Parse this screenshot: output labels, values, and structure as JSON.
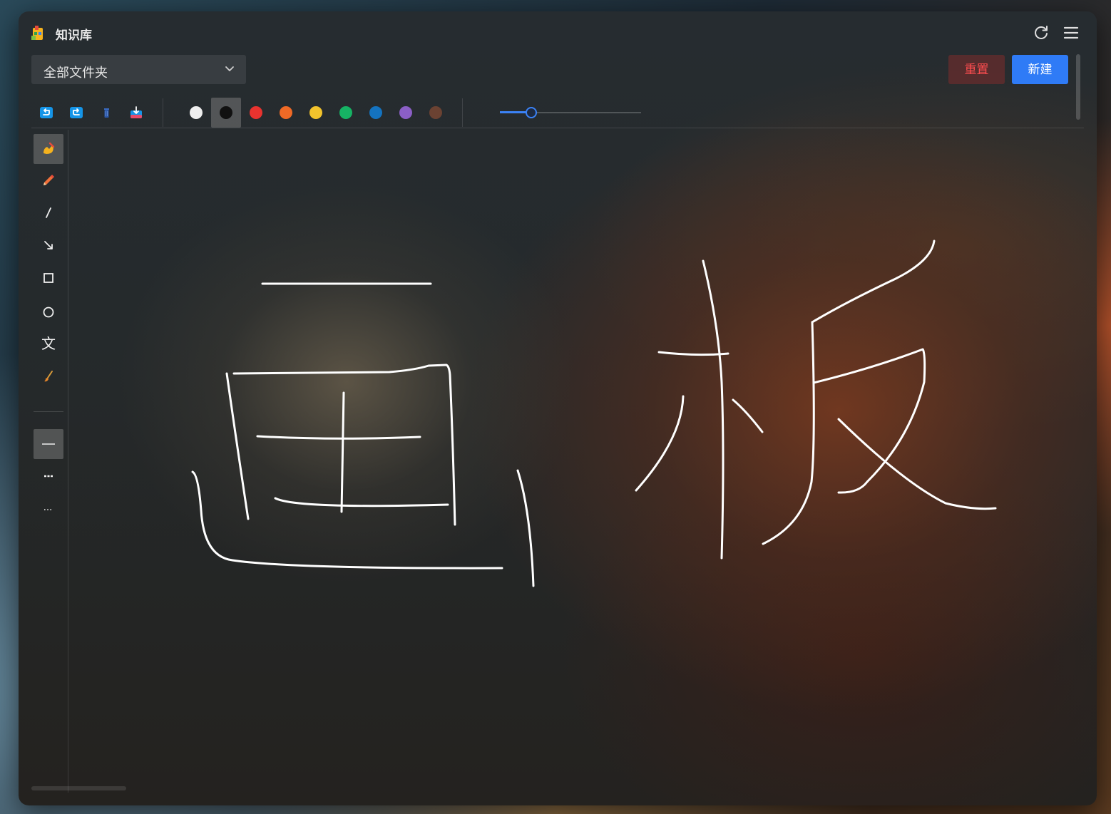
{
  "app": {
    "title": "知识库"
  },
  "folder_select": {
    "value": "全部文件夹"
  },
  "buttons": {
    "reset": "重置",
    "new": "新建"
  },
  "toolbar": {
    "actions": [
      "undo-icon",
      "redo-icon",
      "trash-icon",
      "download-icon"
    ],
    "colors": [
      "#eeeeee",
      "#111111",
      "#e8332f",
      "#f06a26",
      "#f2c32c",
      "#16b364",
      "#1473c0",
      "#8b5fc6",
      "#6b4232"
    ],
    "selected_color": "#111111",
    "stroke_width_fraction": 0.22
  },
  "sidebar": {
    "tools": [
      "hand-draw-icon",
      "pencil-icon",
      "line-icon",
      "arrow-icon",
      "rectangle-icon",
      "circle-icon",
      "text-icon",
      "brush-icon"
    ],
    "text_tool_label": "文",
    "line_styles": [
      "solid-line-icon",
      "dashed-line-icon",
      "dotted-line-icon"
    ]
  }
}
